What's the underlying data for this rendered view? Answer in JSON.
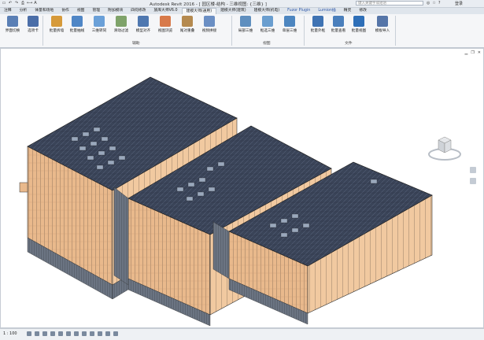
{
  "window": {
    "title": "Autodesk Revit 2016 -   [ 园区楼-结构 - 三维视图: {三维} ]",
    "search_placeholder": "键入关键字或短语",
    "login": "登录"
  },
  "tabs": [
    {
      "label": "注释"
    },
    {
      "label": "分析"
    },
    {
      "label": "体量和场地"
    },
    {
      "label": "协作"
    },
    {
      "label": "视图"
    },
    {
      "label": "管理"
    },
    {
      "label": "附加模块"
    },
    {
      "label": "四何修改"
    },
    {
      "label": "族库大师V6.0"
    },
    {
      "label": "建模大师(通用)"
    },
    {
      "label": "建模大师(建筑)"
    },
    {
      "label": "建模大师(机电)"
    },
    {
      "label": "Fuzor Plugin"
    },
    {
      "label": "Lumion插"
    },
    {
      "label": "精灵"
    },
    {
      "label": "修改"
    }
  ],
  "ribbon": {
    "buttons": [
      {
        "label": "界面切换",
        "color": "#5a7fb5"
      },
      {
        "label": "选项卡",
        "color": "#4b6ea8"
      },
      {
        "label": "批量拆墙",
        "color": "#d69a3a"
      },
      {
        "label": "批量抽线",
        "color": "#4f86c6"
      },
      {
        "label": "三维转同",
        "color": "#6aa0d8"
      },
      {
        "label": "滑动过滤",
        "color": "#7fa36a"
      },
      {
        "label": "模型对齐",
        "color": "#4f78b0"
      },
      {
        "label": "视图浏览",
        "color": "#d87a4a"
      },
      {
        "label": "尾对重叠",
        "color": "#b58a4f"
      },
      {
        "label": "视频拼接",
        "color": "#6b8fc4"
      },
      {
        "label": "局部三维",
        "color": "#5f8fbf"
      },
      {
        "label": "框选三维",
        "color": "#6a9ecf"
      },
      {
        "label": "单层三维",
        "color": "#4d86c0"
      },
      {
        "label": "批量外框",
        "color": "#3f73b3"
      },
      {
        "label": "批量查看",
        "color": "#4a7fbc"
      },
      {
        "label": "批量视图",
        "color": "#2e6fb8"
      },
      {
        "label": "模板导入",
        "color": "#5575a8"
      }
    ],
    "panels": [
      {
        "label": "辅助"
      },
      {
        "label": "视图"
      },
      {
        "label": "文件"
      }
    ]
  },
  "statusbar": {
    "scale": "1 : 100"
  },
  "icons": {
    "undo": "↶",
    "redo": "↷",
    "print": "⎙",
    "measure": "⟷",
    "text": "A",
    "close": "✕",
    "minimize": "▁",
    "restore": "❐",
    "binoculars": "◎",
    "star": "☆",
    "help": "?"
  }
}
